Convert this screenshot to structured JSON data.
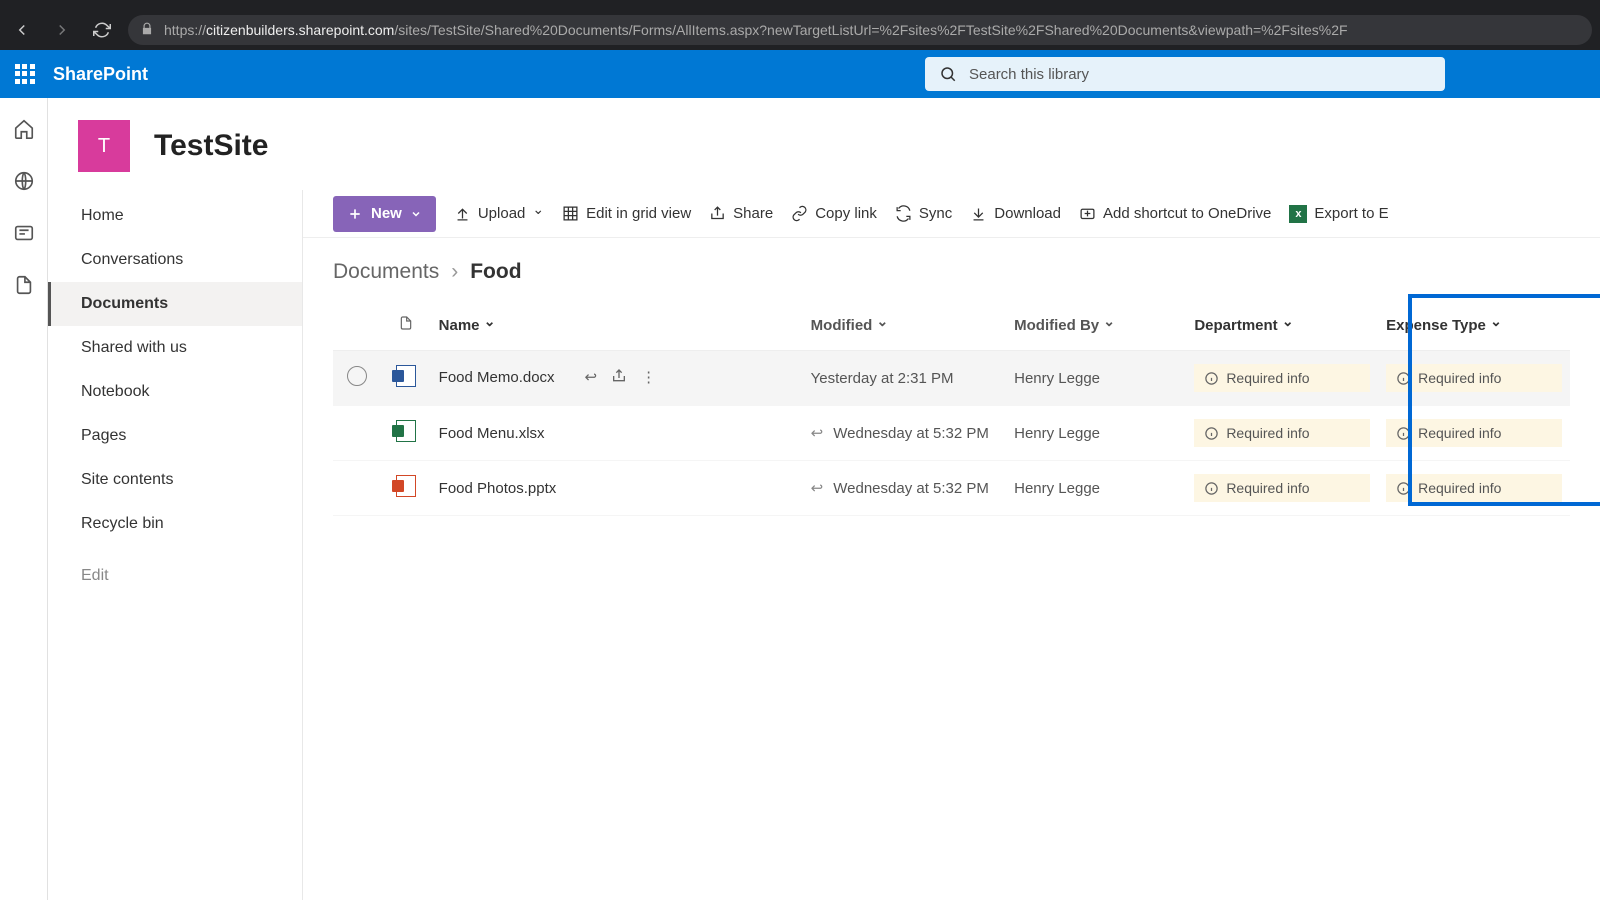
{
  "browser": {
    "url_prefix": "https://",
    "url_domain": "citizenbuilders.sharepoint.com",
    "url_path": "/sites/TestSite/Shared%20Documents/Forms/AllItems.aspx?newTargetListUrl=%2Fsites%2FTestSite%2FShared%20Documents&viewpath=%2Fsites%2F"
  },
  "topbar": {
    "brand": "SharePoint",
    "search_placeholder": "Search this library"
  },
  "site": {
    "logo_letter": "T",
    "title": "TestSite"
  },
  "sidenav": {
    "items": [
      "Home",
      "Conversations",
      "Documents",
      "Shared with us",
      "Notebook",
      "Pages",
      "Site contents",
      "Recycle bin"
    ],
    "active_index": 2,
    "edit": "Edit"
  },
  "toolbar": {
    "new": "New",
    "upload": "Upload",
    "edit_grid": "Edit in grid view",
    "share": "Share",
    "copy_link": "Copy link",
    "sync": "Sync",
    "download": "Download",
    "shortcut": "Add shortcut to OneDrive",
    "export": "Export to E"
  },
  "breadcrumb": {
    "root": "Documents",
    "leaf": "Food"
  },
  "columns": {
    "name": "Name",
    "modified": "Modified",
    "modified_by": "Modified By",
    "department": "Department",
    "expense_type": "Expense Type"
  },
  "files": [
    {
      "name": "Food Memo.docx",
      "type": "docx",
      "modified": "Yesterday at 2:31 PM",
      "by": "Henry Legge",
      "dept": "Required info",
      "exp": "Required info",
      "hovered": true,
      "shared": true
    },
    {
      "name": "Food Menu.xlsx",
      "type": "xlsx",
      "modified": "Wednesday at 5:32 PM",
      "by": "Henry Legge",
      "dept": "Required info",
      "exp": "Required info",
      "hovered": false,
      "shared": true
    },
    {
      "name": "Food Photos.pptx",
      "type": "pptx",
      "modified": "Wednesday at 5:32 PM",
      "by": "Henry Legge",
      "dept": "Required info",
      "exp": "Required info",
      "hovered": false,
      "shared": true
    }
  ]
}
